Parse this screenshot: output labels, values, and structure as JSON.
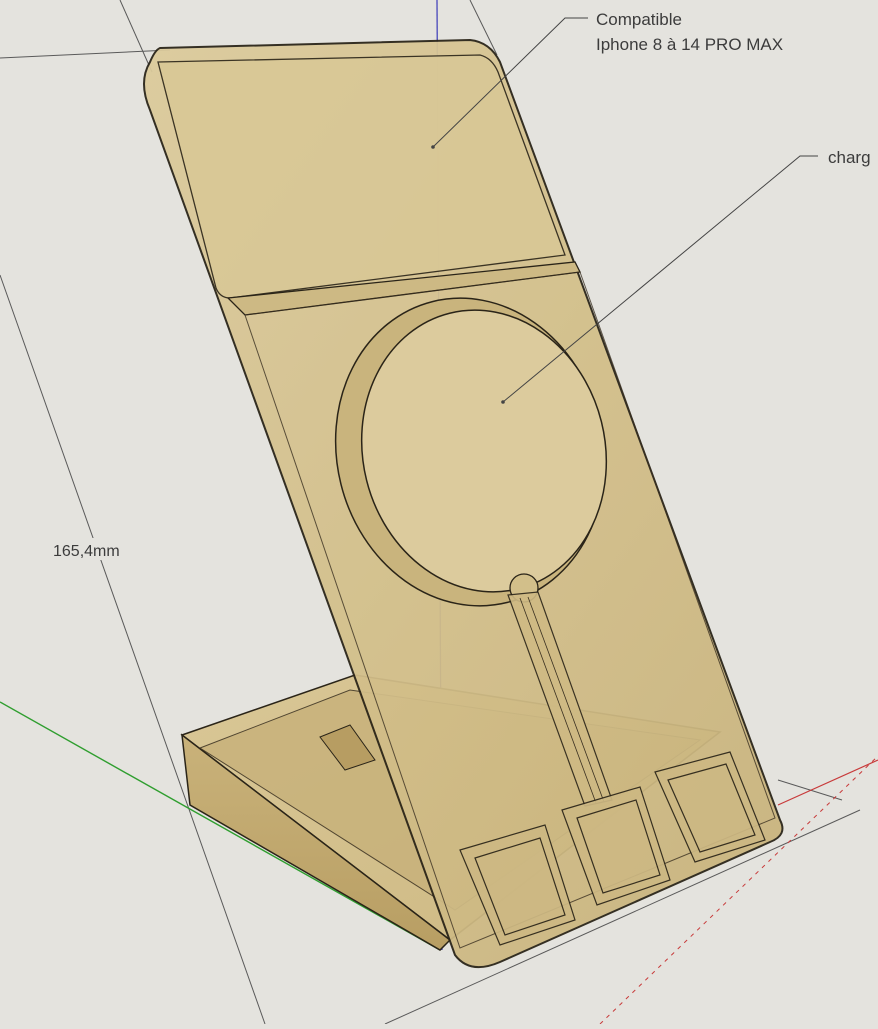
{
  "annotations": {
    "compatible_line1": "Compatible",
    "compatible_line2": "Iphone 8 à 14 PRO MAX",
    "charger": "charg"
  },
  "dimension": {
    "height_label": "165,4mm"
  },
  "colors": {
    "background": "#e4e3de",
    "wood_light": "#d9c795",
    "wood_mid": "#c9b37a",
    "wood_dark": "#b79d62",
    "edge": "#2a2418",
    "axis_green": "#2f9e2f",
    "axis_red": "#c83a3a",
    "axis_blue": "#3a3ab8"
  }
}
